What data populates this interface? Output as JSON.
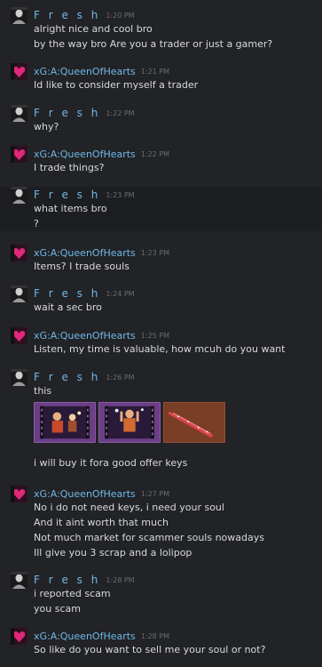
{
  "messages": [
    {
      "sender": "Fresh",
      "sender_display": "F r e s h",
      "time": "1:20 PM",
      "lines": [
        "alright nice and cool bro",
        "by the way bro Are you a trader or just a gamer?"
      ]
    },
    {
      "sender": "xG:A:QueenOfHearts",
      "sender_display": "xG:A:QueenOfHearts",
      "time": "1:21 PM",
      "lines": [
        "Id like to consider myself a trader"
      ]
    },
    {
      "sender": "Fresh",
      "sender_display": "F r e s h",
      "time": "1:22 PM",
      "lines": [
        "why?"
      ]
    },
    {
      "sender": "xG:A:QueenOfHearts",
      "sender_display": "xG:A:QueenOfHearts",
      "time": "1:22 PM",
      "lines": [
        "I trade things?"
      ]
    },
    {
      "sender": "Fresh",
      "sender_display": "F r e s h",
      "time": "1:23 PM",
      "lines": [
        "what items bro",
        "?"
      ]
    },
    {
      "sender": "xG:A:QueenOfHearts",
      "sender_display": "xG:A:QueenOfHearts",
      "time": "1:23 PM",
      "lines": [
        "Items? I trade souls"
      ]
    },
    {
      "sender": "Fresh",
      "sender_display": "F r e s h",
      "time": "1:24 PM",
      "lines": [
        "wait a sec bro"
      ]
    },
    {
      "sender": "xG:A:QueenOfHearts",
      "sender_display": "xG:A:QueenOfHearts",
      "time": "1:25 PM",
      "lines": [
        "Listen, my time is valuable, how mcuh do you want"
      ]
    },
    {
      "sender": "Fresh",
      "sender_display": "F r e s h",
      "time": "1:26 PM",
      "lines": [
        "this"
      ],
      "items": [
        "unusual-taunt-card",
        "unusual-taunt-card",
        "strange-weapon"
      ],
      "after_lines": [
        "i will buy it fora good offer keys"
      ]
    },
    {
      "sender": "xG:A:QueenOfHearts",
      "sender_display": "xG:A:QueenOfHearts",
      "time": "1:27 PM",
      "lines": [
        "No i do not need keys, i need your soul",
        "And it aint worth that much",
        "Not much market for scammer souls nowadays",
        "Ill give you 3 scrap and a lolipop"
      ]
    },
    {
      "sender": "Fresh",
      "sender_display": "F r e s h",
      "time": "1:28 PM",
      "lines": [
        "i reported scam",
        "you scam"
      ]
    },
    {
      "sender": "xG:A:QueenOfHearts",
      "sender_display": "xG:A:QueenOfHearts",
      "time": "1:28 PM",
      "lines": [
        "So like do you want to sell me your soul or not?"
      ]
    }
  ],
  "colors": {
    "background": "#222326",
    "name": "#6fb8e8",
    "text": "#d8d9db",
    "time": "#6a6c70"
  }
}
